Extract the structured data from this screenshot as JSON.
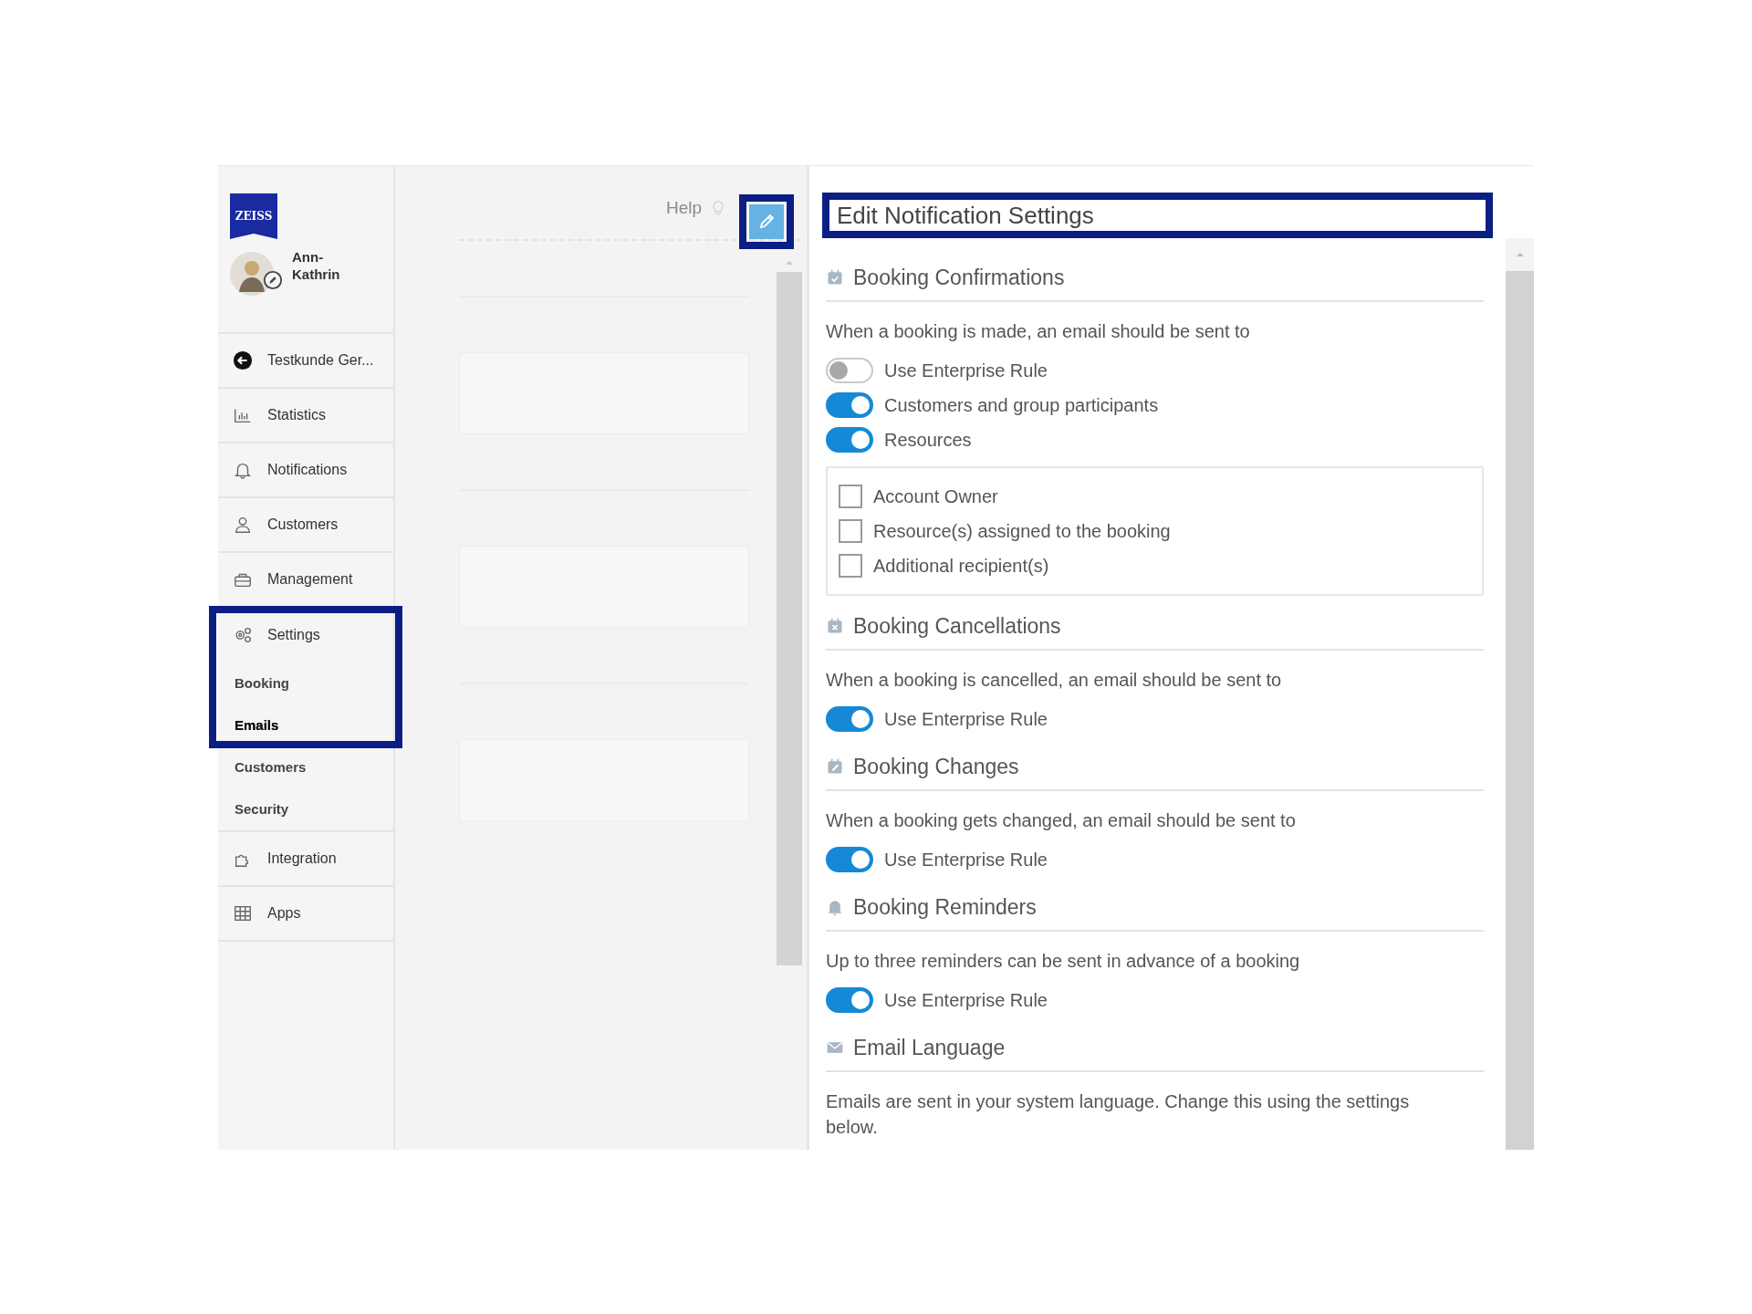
{
  "brand": {
    "logo": "ZEISS"
  },
  "user": {
    "name": "Ann-Kathrin"
  },
  "back_link": {
    "label": "Testkunde Ger..."
  },
  "nav": [
    {
      "label": "Statistics",
      "highlighted": false
    },
    {
      "label": "Notifications",
      "highlighted": false
    },
    {
      "label": "Customers",
      "highlighted": false
    },
    {
      "label": "Management",
      "highlighted": false
    },
    {
      "label": "Settings",
      "highlighted": true,
      "expanded": true,
      "children": [
        {
          "label": "Booking",
          "selected": false,
          "highlighted": true
        },
        {
          "label": "Emails",
          "selected": true,
          "highlighted": true
        },
        {
          "label": "Customers",
          "selected": false,
          "highlighted": false
        },
        {
          "label": "Security",
          "selected": false,
          "highlighted": false
        }
      ]
    },
    {
      "label": "Integration",
      "highlighted": false
    },
    {
      "label": "Apps",
      "highlighted": false
    }
  ],
  "middle": {
    "help": "Help",
    "edit_button": {
      "highlighted": true
    }
  },
  "panel": {
    "title": "Edit Notification Settings",
    "highlighted": true,
    "sections": [
      {
        "title": "Booking Confirmations",
        "description": "When a booking is made, an email should be sent to",
        "options": [
          {
            "kind": "toggle",
            "label": "Use Enterprise Rule",
            "on": false
          },
          {
            "kind": "toggle",
            "label": "Customers and group participants",
            "on": true
          },
          {
            "kind": "toggle",
            "label": "Resources",
            "on": true
          }
        ],
        "checkboxes": [
          {
            "label": "Account Owner",
            "checked": false
          },
          {
            "label": "Resource(s) assigned to the booking",
            "checked": false
          },
          {
            "label": "Additional recipient(s)",
            "checked": false
          }
        ]
      },
      {
        "title": "Booking Cancellations",
        "description": "When a booking is cancelled, an email should be sent to",
        "options": [
          {
            "kind": "toggle",
            "label": "Use Enterprise Rule",
            "on": true
          }
        ]
      },
      {
        "title": "Booking Changes",
        "description": "When a booking gets changed, an email should be sent to",
        "options": [
          {
            "kind": "toggle",
            "label": "Use Enterprise Rule",
            "on": true
          }
        ]
      },
      {
        "title": "Booking Reminders",
        "description": "Up to three reminders can be sent in advance of a booking",
        "options": [
          {
            "kind": "toggle",
            "label": "Use Enterprise Rule",
            "on": true
          }
        ]
      },
      {
        "title": "Email Language",
        "description": "Emails are sent in your system language. Change this using the settings below."
      }
    ]
  }
}
